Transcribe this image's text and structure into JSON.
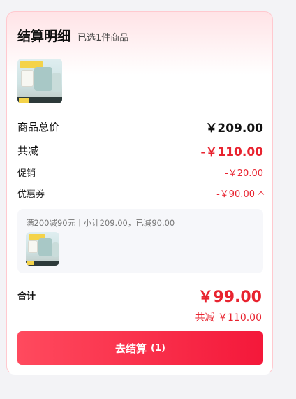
{
  "header": {
    "title": "结算明细",
    "subtitle": "已选1件商品"
  },
  "summary": {
    "goods_total_label": "商品总价",
    "goods_total_value": "￥209.00",
    "discount_total_label": "共减",
    "discount_total_value": "-￥110.00",
    "promotion_label": "促销",
    "promotion_value": "-￥20.00",
    "coupon_label": "优惠券",
    "coupon_value": "-￥90.00"
  },
  "coupon_detail": {
    "text": "满200减90元｜小计209.00，已减90.00"
  },
  "footer": {
    "sum_label": "合计",
    "sum_value": "￥99.00",
    "sum_discount": "共减 ￥110.00",
    "checkout_label": "去结算",
    "checkout_count": "(1)"
  },
  "colors": {
    "accent": "#e8232f",
    "button_start": "#ff4a5e",
    "button_end": "#f4183a"
  }
}
